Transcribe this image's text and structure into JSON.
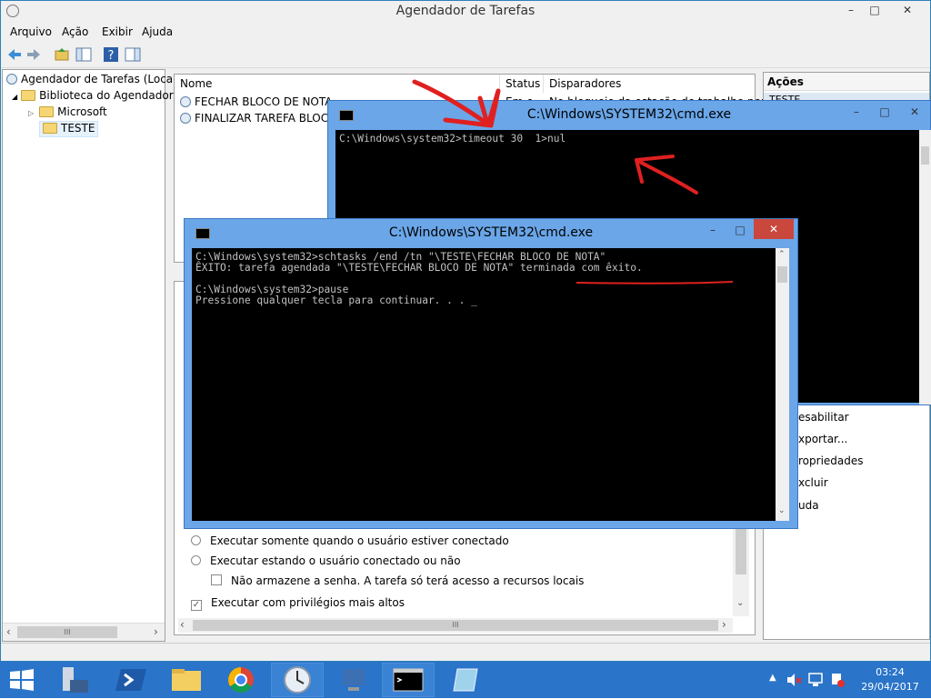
{
  "window": {
    "title": "Agendador de Tarefas",
    "min": "–",
    "max": "□",
    "close": "✕"
  },
  "menu": [
    "Arquivo",
    "Ação",
    "Exibir",
    "Ajuda"
  ],
  "tree": {
    "root": "Agendador de Tarefas (Local)",
    "library": "Biblioteca do Agendador",
    "microsoft": "Microsoft",
    "teste": "TESTE"
  },
  "tasks": {
    "columns": [
      "Nome",
      "Status",
      "Disparadores"
    ],
    "rows": [
      {
        "name": "FECHAR BLOCO DE NOTA",
        "status": "Em e...",
        "trigger": "No bloqueio da estação de trabalho por qu..."
      },
      {
        "name": "FINALIZAR TAREFA BLOCO",
        "status": "",
        "trigger": ""
      }
    ]
  },
  "actions": {
    "header": "Ações",
    "section": "TESTE",
    "items": [
      "esabilitar",
      "xportar...",
      "ropriedades",
      "xcluir",
      "uda"
    ]
  },
  "options": {
    "opt1": "Executar somente quando o usuário estiver conectado",
    "opt2": "Executar estando o usuário conectado ou não",
    "opt3": "Não armazene a senha. A tarefa só terá acesso a recursos locais",
    "opt4": "Executar com privilégios mais altos"
  },
  "cmd_back": {
    "title": "C:\\Windows\\SYSTEM32\\cmd.exe",
    "lines": [
      "C:\\Windows\\system32>timeout 30  1>nul"
    ]
  },
  "cmd_front": {
    "title": "C:\\Windows\\SYSTEM32\\cmd.exe",
    "line1": "C:\\Windows\\system32>schtasks /end /tn \"\\TESTE\\FECHAR BLOCO DE NOTA\"",
    "line2a": "ÊXITO: tarefa agendada \"\\TESTE\\FECHAR BLOCO DE NOTA\" ",
    "line2b": "terminada com êxito.",
    "line3": "",
    "line4": "C:\\Windows\\system32>pause",
    "line5": "Pressione qualquer tecla para continuar. . . _"
  },
  "scroll_glyph": "III",
  "tray": {
    "time": "03:24",
    "date": "29/04/2017"
  },
  "colors": {
    "accent": "#2a74c9",
    "cmd_frame": "#6aa6e8",
    "annotation": "#e02020"
  }
}
